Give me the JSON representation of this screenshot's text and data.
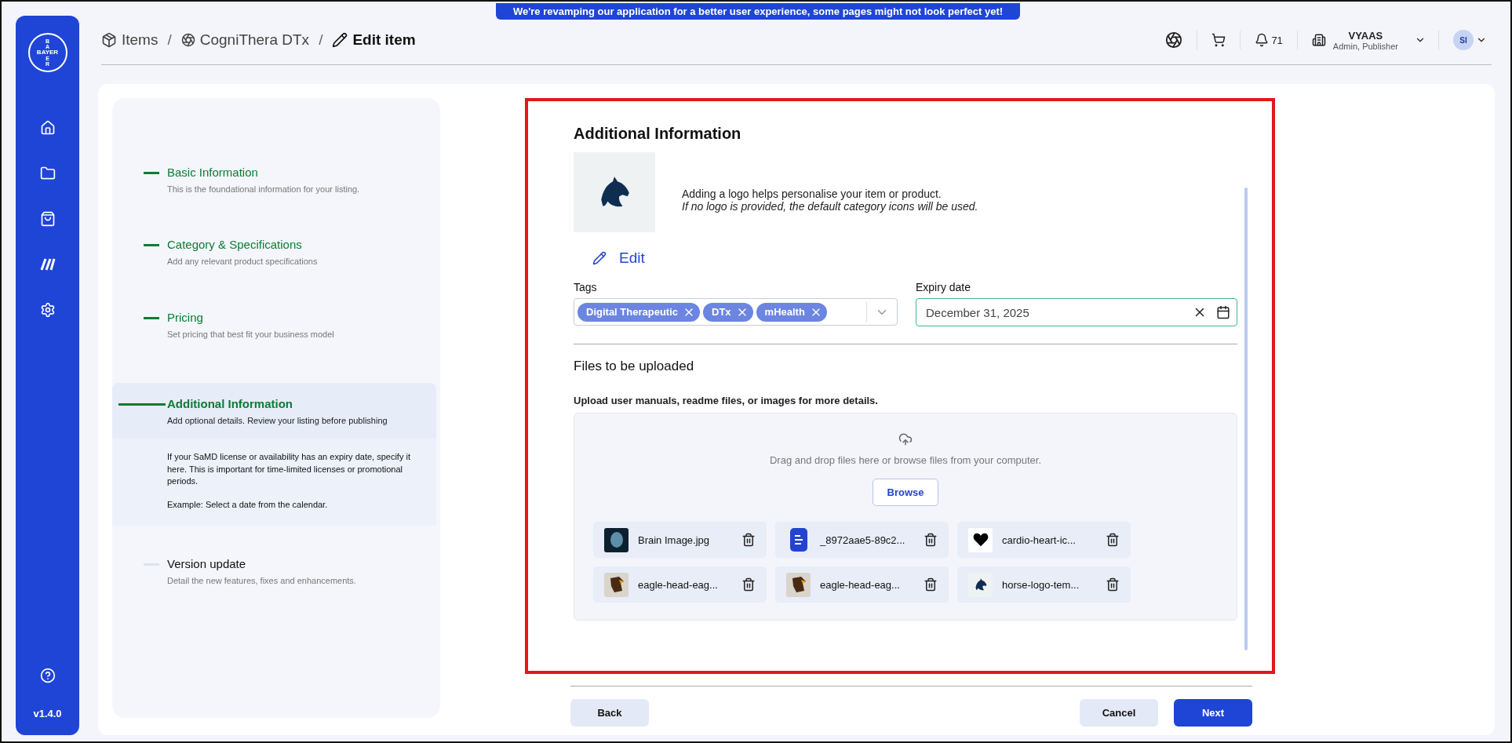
{
  "banner": "We're revamping our application for a better user experience, some pages might not look perfect yet!",
  "logo": {
    "top": "BA",
    "middle": "BAYER",
    "bottom": "ER"
  },
  "nav": {
    "items": [
      {
        "kind": "home"
      },
      {
        "kind": "folder"
      },
      {
        "kind": "bag"
      },
      {
        "kind": "brand"
      },
      {
        "kind": "settings"
      }
    ],
    "version": "v1.4.0"
  },
  "breadcrumb": [
    {
      "kind": "box",
      "label": "Items"
    },
    {
      "kind": "cluster",
      "separator": "/",
      "label": "CogniThera DTx"
    },
    {
      "kind": "pencil",
      "separator": "/",
      "label": "Edit item"
    }
  ],
  "header": {
    "notifications": "71",
    "org": "VYAAS",
    "role": "Admin, Publisher",
    "avatar": "SI"
  },
  "steps": [
    {
      "kind": "done",
      "title": "Basic Information",
      "description": "This is the foundational information for your listing."
    },
    {
      "kind": "done",
      "title": "Category & Specifications",
      "description": "Add any relevant product specifications"
    },
    {
      "kind": "done",
      "title": "Pricing",
      "description": "Set pricing that best fit your business model"
    },
    {
      "kind": "active",
      "title": "Additional Information",
      "description": "Add optional details. Review your listing before publishing",
      "help": [
        "If your SaMD license or availability has an expiry date, specify it here. This is important for time-limited licenses or promotional periods.",
        "Example: Select a date from the calendar."
      ]
    },
    {
      "kind": "pending",
      "title": "Version update",
      "description": "Detail the new features, fixes and enhancements."
    }
  ],
  "form": {
    "title": "Additional Information",
    "logo_hint": "Adding a logo helps personalise your item or product.",
    "logo_note": "If no logo is provided, the default category icons will be used.",
    "edit": "Edit",
    "tags": {
      "label": "Tags",
      "items": [
        "Digital Therapeutic",
        "DTx",
        "mHealth"
      ]
    },
    "expiry": {
      "label": "Expiry date",
      "value": "December 31, 2025"
    },
    "files": {
      "title": "Files to be uploaded",
      "description": "Upload user manuals, readme files, or images for more details.",
      "drop_text": "Drag and drop files here or browse files from your computer.",
      "browse": "Browse",
      "items": [
        {
          "kind": "scan",
          "name": "Brain Image.jpg"
        },
        {
          "kind": "document",
          "name": "_8972aae5-89c2..."
        },
        {
          "kind": "heart",
          "name": "cardio-heart-ic..."
        },
        {
          "kind": "eagle",
          "name": "eagle-head-eag..."
        },
        {
          "kind": "eagle",
          "name": "eagle-head-eag..."
        },
        {
          "kind": "horse",
          "name": "horse-logo-tem..."
        }
      ]
    }
  },
  "footer": {
    "back": "Back",
    "cancel": "Cancel",
    "next": "Next"
  }
}
